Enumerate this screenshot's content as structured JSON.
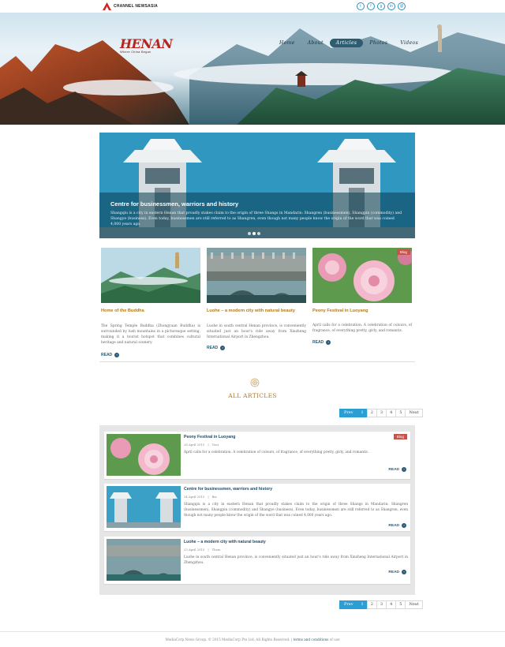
{
  "topbar": {
    "brand": "CHANNEL NEWSASIA",
    "social": [
      {
        "name": "twitter-icon",
        "glyph": "t"
      },
      {
        "name": "facebook-icon",
        "glyph": "f"
      },
      {
        "name": "googleplus-icon",
        "glyph": "g"
      },
      {
        "name": "linkedin-icon",
        "glyph": "in"
      },
      {
        "name": "email-icon",
        "glyph": "@"
      }
    ]
  },
  "header": {
    "logo_title": "HENAN",
    "logo_subtitle": "Where China Began",
    "nav": [
      "Home",
      "About",
      "Articles",
      "Photos",
      "Videos"
    ],
    "active_nav": "Articles"
  },
  "slider": {
    "title": "Centre for businessmen, warriors and history",
    "text": "Shangqiu is a city in eastern Henan that proudly stakes claim to the origin of three Shangs in Mandarin: Shangren (businessmen), Shangpin (commodity) and Shangye (business). Even today, businessmen are still referred to as Shangren, even though not many people know the origin of the word that was coined 4,000 years ago."
  },
  "featured": [
    {
      "title": "Home of the Buddha",
      "text": "The Spring Temple Buddha (Zhongyuan Buddha) is surrounded by lush mountains in a picturesque setting, making it a tourist hotspot that combines cultural heritage and natural scenery.",
      "read": "READ",
      "badge": ""
    },
    {
      "title": "Luohe – a modern city with natural beauty",
      "text": "Luohe in south central Henan province, is conveniently situated just an hour's ride away from Xinzheng International Airport in Zhengzhou.",
      "read": "READ",
      "badge": ""
    },
    {
      "title": "Peony Festival in Luoyang",
      "text": "April calls for a celebration. A celebration of colours, of fragrance, of everything pretty, girly, and romantic.",
      "read": "READ",
      "badge": "Blog"
    }
  ],
  "section": {
    "heading": "ALL ARTICLES"
  },
  "pagination": {
    "prev": "Prev",
    "pages": [
      "1",
      "2",
      "3",
      "4",
      "5"
    ],
    "current": "1",
    "next": "Next"
  },
  "articles": [
    {
      "title": "Peony Festival in Luoyang",
      "date": "28 April 2015",
      "tag": "Tour",
      "text": "April calls for a celebration. A celebration of colours, of fragrance, of everything pretty, girly, and romantic.",
      "read": "READ",
      "badge": "Blog"
    },
    {
      "title": "Centre for businessmen, warriors and history",
      "date": "24 April 2015",
      "tag": "Biz",
      "text": "Shangqiu is a city in eastern Henan that proudly stakes claim to the origin of three Shangs in Mandarin: Shangren (businessmen), Shangpin (commodity) and Shangye (business). Even today, businessmen are still referred to as Shangren, even though not many people know the origin of the word that was coined 4,000 years ago.",
      "read": "READ",
      "badge": ""
    },
    {
      "title": "Luohe – a modern city with natural beauty",
      "date": "23 April 2015",
      "tag": "Them",
      "text": "Luohe in south central Henan province, is conveniently situated just an hour's ride away from Xinzheng International Airport in Zhengzhou.",
      "read": "READ",
      "badge": ""
    }
  ],
  "footer": {
    "copyright": "MediaCorp News Group. © 2015 MediaCorp Pte Ltd. All Rights Reserved. |",
    "terms": "terms and conditions",
    "suffix": "of use"
  },
  "colors": {
    "accent": "#2b9fd3",
    "gold": "#b07a1e",
    "badge": "#c9524a",
    "nav_active": "#2e5c70"
  }
}
